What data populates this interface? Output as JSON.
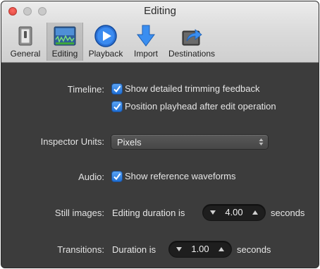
{
  "window": {
    "title": "Editing"
  },
  "toolbar": {
    "items": [
      {
        "label": "General",
        "icon": "switch-icon"
      },
      {
        "label": "Editing",
        "icon": "editing-waveform-icon",
        "selected": true
      },
      {
        "label": "Playback",
        "icon": "play-icon"
      },
      {
        "label": "Import",
        "icon": "import-arrow-icon"
      },
      {
        "label": "Destinations",
        "icon": "share-arrow-icon"
      }
    ]
  },
  "settings": {
    "timeline": {
      "label": "Timeline:",
      "options": [
        {
          "text": "Show detailed trimming feedback",
          "checked": true
        },
        {
          "text": "Position playhead after edit operation",
          "checked": true
        }
      ]
    },
    "inspector_units": {
      "label": "Inspector Units:",
      "value": "Pixels"
    },
    "audio": {
      "label": "Audio:",
      "option": {
        "text": "Show reference waveforms",
        "checked": true
      }
    },
    "still_images": {
      "label": "Still images:",
      "prefix": "Editing duration is",
      "value": "4.00",
      "suffix": "seconds"
    },
    "transitions": {
      "label": "Transitions:",
      "prefix": "Duration is",
      "value": "1.00",
      "suffix": "seconds"
    }
  },
  "colors": {
    "accent": "#2f7fe6",
    "panel_bg": "#3c3c3c",
    "close_button": "#ec5f57"
  }
}
